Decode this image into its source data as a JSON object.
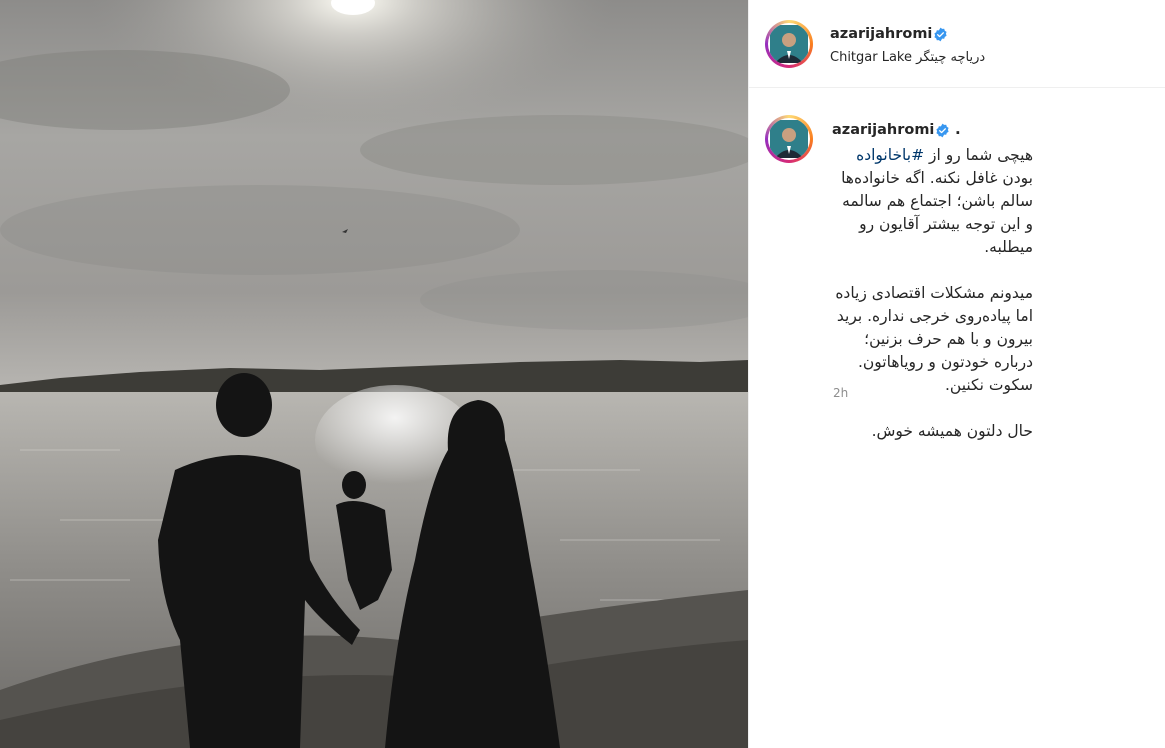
{
  "post": {
    "image_alt": "family at the lake",
    "username": "azarijahromi",
    "location_fa": "دریاچه چیتگر",
    "location_en": "Chitgar Lake",
    "caption_dot": ".",
    "caption": {
      "line1_prefix": "هیچی شما رو از ",
      "hashtag": "#باخانواده",
      "line1_suffix": " بودن غافل نکنه. اگه خانواده‌ها سالم باشن؛ اجتماع هم سالمه و این توجه بیشتر آقایون رو میطلبه.",
      "paragraph2": "میدونم مشکلات اقتصادی زیاده اما پیاده‌روی خرجی نداره. برید بیرون و با هم حرف بزنین؛ درباره خودتون و رویاهاتون. سکوت نکنین.",
      "paragraph3": "حال دلتون همیشه خوش."
    },
    "time": "2h"
  },
  "icons": {
    "verified": "verified-badge-icon",
    "avatar": "profile-avatar"
  },
  "colors": {
    "verified_blue": "#3897f0",
    "hashtag": "#00376b",
    "muted": "#8e8e8e"
  }
}
